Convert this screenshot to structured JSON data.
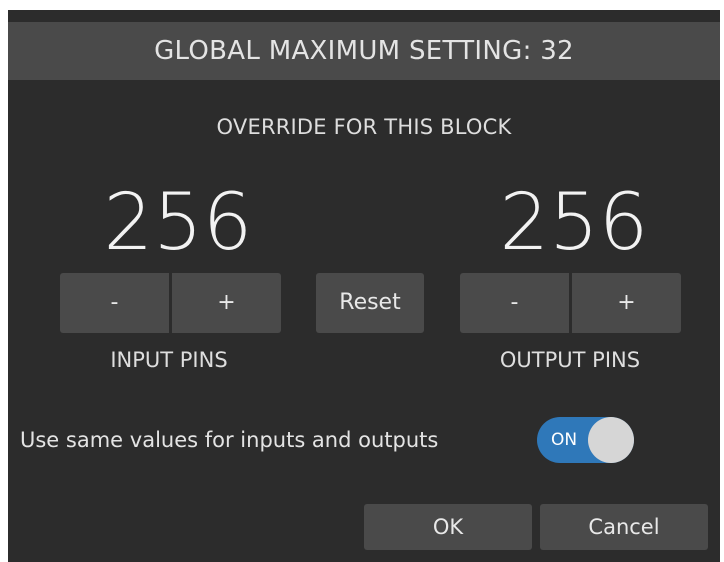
{
  "dialog": {
    "header": "GLOBAL MAXIMUM SETTING: 32",
    "override_label": "OVERRIDE FOR THIS BLOCK",
    "input": {
      "value": "256",
      "minus_label": "-",
      "plus_label": "+",
      "label": "INPUT PINS"
    },
    "reset_label": "Reset",
    "output": {
      "value": "256",
      "minus_label": "-",
      "plus_label": "+",
      "label": "OUTPUT PINS"
    },
    "same_values_label": "Use same values for inputs and outputs",
    "toggle": {
      "state_label": "ON",
      "on": true,
      "color_on": "#2f78b9"
    },
    "ok_label": "OK",
    "cancel_label": "Cancel"
  }
}
